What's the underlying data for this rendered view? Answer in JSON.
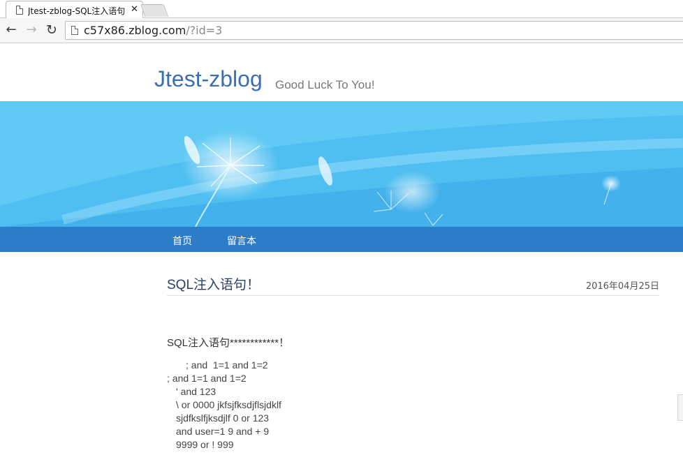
{
  "browser": {
    "tab": {
      "title": "Jtest-zblog-SQL注入语句",
      "close_glyph": "✕"
    },
    "nav": {
      "back_glyph": "←",
      "forward_glyph": "→",
      "reload_glyph": "↻"
    },
    "address": {
      "host": "c57x86.zblog.com",
      "path": "/?id=3"
    }
  },
  "site": {
    "title": "Jtest-zblog",
    "tagline": "Good Luck To You!",
    "colors": {
      "title": "#3a6fb0",
      "navbar": "#2c7cc8",
      "banner": "#55c6f3"
    }
  },
  "navbar": {
    "items": [
      "首页",
      "留言本"
    ]
  },
  "post": {
    "title": "SQL注入语句！",
    "date": "2016年04月25日",
    "lead": "SQL注入语句************！",
    "lines": [
      "; and  1=1 and 1=2",
      "; and 1=1 and 1=2",
      "' and 123",
      "\\ or 0000 jkfsjfksdjflsjdklf",
      "sjdfkslfjksdjlf 0 or 123",
      "and user=1 9 and + 9",
      "9999 or ! 999"
    ]
  }
}
